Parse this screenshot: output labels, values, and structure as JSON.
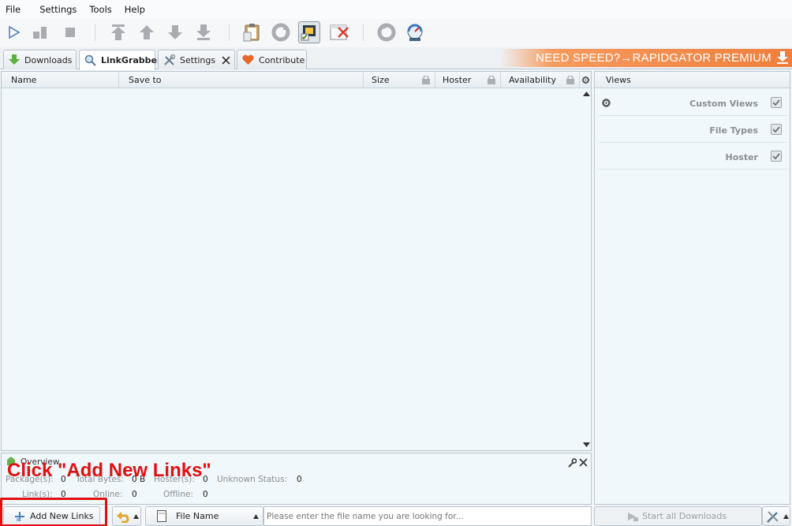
{
  "menu": [
    "File",
    "Settings",
    "Tools",
    "Help"
  ],
  "toolbar": {
    "icons": [
      "play-icon",
      "pause-icon",
      "stop-icon",
      "move-top-icon",
      "move-up-icon",
      "move-down-icon",
      "move-bottom-icon",
      "clipboard-icon",
      "reconnect-icon",
      "premium-icon",
      "clear-icon",
      "update-icon",
      "speed-icon"
    ]
  },
  "tabs": [
    {
      "label": "Downloads",
      "icon": "download-arrow-icon"
    },
    {
      "label": "LinkGrabber",
      "icon": "magnifier-icon"
    },
    {
      "label": "Settings",
      "icon": "tools-icon"
    },
    {
      "label": "Contribute",
      "icon": "heart-icon"
    }
  ],
  "promo": {
    "text": "NEED SPEED?→RAPIDGATOR PREMIUM"
  },
  "table": {
    "columns": [
      "Name",
      "Save to",
      "Size",
      "Hoster",
      "Availability"
    ]
  },
  "overview": {
    "title": "Overview",
    "package_label": "Package(s):",
    "package_value": "0",
    "bytes_label": "Total Bytes:",
    "bytes_value": "0 B",
    "hoster_label": "Hoster(s):",
    "hoster_value": "0",
    "unknown_label": "Unknown Status:",
    "unknown_value": "0",
    "links_label": "Link(s):",
    "links_value": "0",
    "online_label": "Online:",
    "online_value": "0",
    "offline_label": "Offline:",
    "offline_value": "0"
  },
  "callout": {
    "text": "Click \"Add New Links\""
  },
  "bottom": {
    "add_links": "Add New Links",
    "filter_label": "File Name",
    "search_placeholder": "Please enter the file name you are looking for...",
    "start_all": "Start all Downloads"
  },
  "views": {
    "title": "Views",
    "items": [
      "Custom Views",
      "File Types",
      "Hoster"
    ]
  },
  "colors": {
    "accent_red": "#e01010",
    "promo_orange": "#ef7f3c",
    "panel_bg": "#f0f8fc"
  }
}
